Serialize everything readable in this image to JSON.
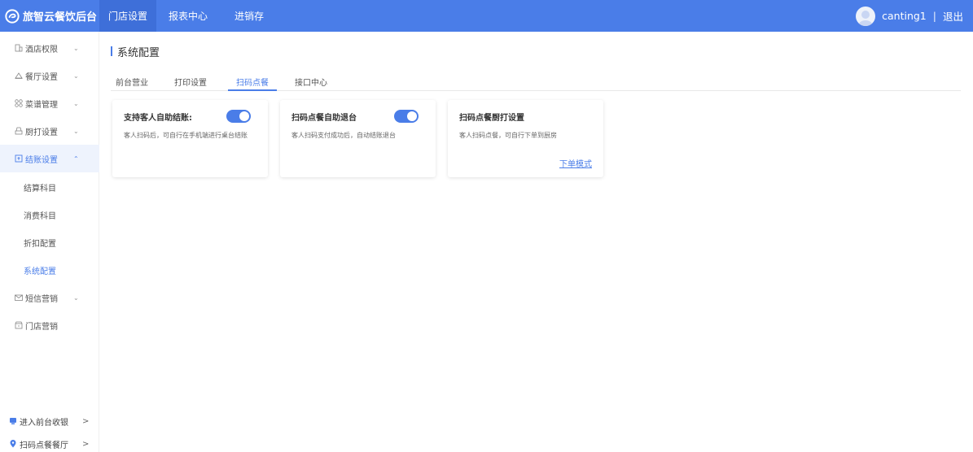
{
  "brand": {
    "name": "旅智云餐饮后台"
  },
  "topnav": [
    {
      "label": "门店设置",
      "active": true
    },
    {
      "label": "报表中心",
      "active": false
    },
    {
      "label": "进销存",
      "active": false
    }
  ],
  "user": {
    "name": "canting1",
    "separator": "|",
    "logout": "退出"
  },
  "sidebar": {
    "items": [
      {
        "label": "酒店权限",
        "icon": "building-icon"
      },
      {
        "label": "餐厅设置",
        "icon": "home-icon"
      },
      {
        "label": "菜谱管理",
        "icon": "grid-icon"
      },
      {
        "label": "厨打设置",
        "icon": "printer-icon"
      },
      {
        "label": "结账设置",
        "icon": "checkout-icon",
        "open": true
      },
      {
        "label": "短信营销",
        "icon": "mail-icon"
      },
      {
        "label": "门店营销",
        "icon": "store-icon"
      }
    ],
    "subitems": [
      {
        "label": "结算科目"
      },
      {
        "label": "消费科目"
      },
      {
        "label": "折扣配置"
      },
      {
        "label": "系统配置",
        "active": true
      }
    ],
    "bottom": [
      {
        "label": "进入前台收银",
        "arrow": ">"
      },
      {
        "label": "扫码点餐餐厅",
        "arrow": ">"
      }
    ]
  },
  "page": {
    "title": "系统配置"
  },
  "tabs": [
    {
      "label": "前台营业"
    },
    {
      "label": "打印设置"
    },
    {
      "label": "扫码点餐",
      "active": true
    },
    {
      "label": "接口中心"
    }
  ],
  "cards": [
    {
      "title": "支持客人自助结账:",
      "desc": "客人扫码后，可自行在手机端进行桌台结账",
      "toggle_on": true
    },
    {
      "title": "扫码点餐自助退台",
      "desc": "客人扫码支付成功后，自动结账退台",
      "toggle_on": true
    },
    {
      "title": "扫码点餐厨打设置",
      "desc": "客人扫码点餐，可自行下单到厨房",
      "link": "下单模式"
    }
  ],
  "colors": {
    "primary": "#4a7de8",
    "topbar": "#4a7de8",
    "active_bg": "#eef3fd"
  }
}
